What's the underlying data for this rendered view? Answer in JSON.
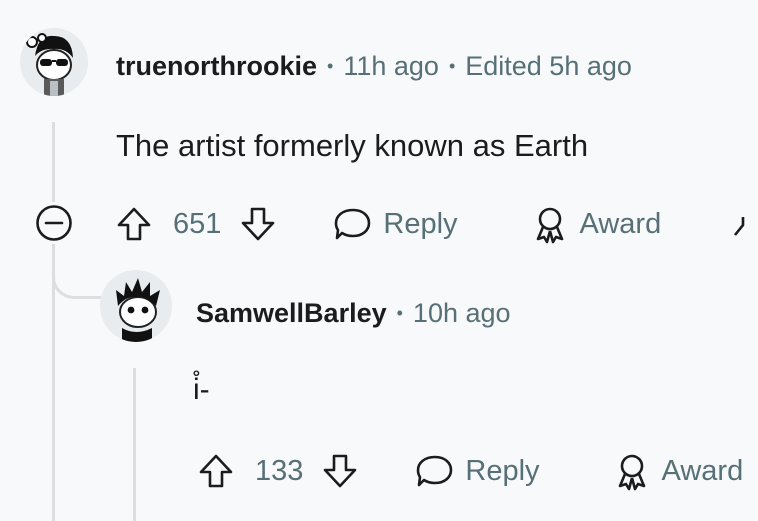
{
  "comments": [
    {
      "username": "truenorthrookie",
      "time": "11h ago",
      "edited": "Edited 5h ago",
      "body": "The artist formerly known as Earth",
      "votes": "651",
      "reply_label": "Reply",
      "award_label": "Award",
      "avatar": "snoo-sunglasses-avatar"
    },
    {
      "username": "SamwellBarley",
      "time": "10h ago",
      "body": "i̊-",
      "votes": "133",
      "reply_label": "Reply",
      "award_label": "Award",
      "avatar": "snoo-spiky-hair-avatar"
    }
  ],
  "separator": "•",
  "icons": {
    "collapse": "collapse-minus-icon",
    "upvote": "upvote-arrow-icon",
    "downvote": "downvote-arrow-icon",
    "reply": "comment-bubble-icon",
    "award": "award-ribbon-icon",
    "share": "share-icon"
  },
  "colors": {
    "background": "#f7f9fa",
    "text": "#1c1c1c",
    "meta": "#576f76",
    "thread_line": "#dcdfe2"
  }
}
